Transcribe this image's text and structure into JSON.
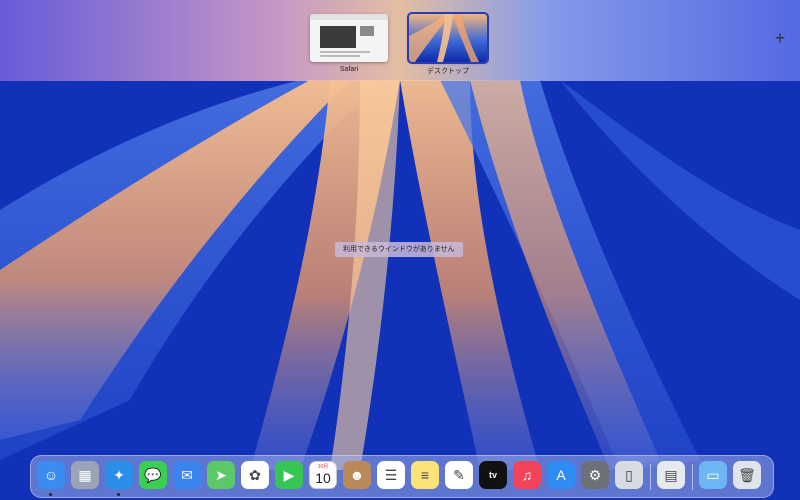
{
  "spaces": {
    "items": [
      {
        "label": "Safari"
      },
      {
        "label": "デスクトップ"
      }
    ],
    "add_symbol": "+"
  },
  "center_message": "利用できるウインドウがありません",
  "dock": {
    "apps": [
      {
        "name": "finder-icon",
        "glyph": "☺",
        "color": "#3b8cf0",
        "running": true
      },
      {
        "name": "launchpad-icon",
        "glyph": "▦",
        "color": "#9aa3b8",
        "running": false
      },
      {
        "name": "safari-icon",
        "glyph": "✦",
        "color": "#2a8fe8",
        "running": true
      },
      {
        "name": "messages-icon",
        "glyph": "💬",
        "color": "#3bcf52",
        "running": false
      },
      {
        "name": "mail-icon",
        "glyph": "✉",
        "color": "#3a84ef",
        "running": false
      },
      {
        "name": "maps-icon",
        "glyph": "➤",
        "color": "#5cc86a",
        "running": false
      },
      {
        "name": "photos-icon",
        "glyph": "✿",
        "color": "#ffffff",
        "running": false
      },
      {
        "name": "facetime-icon",
        "glyph": "▶",
        "color": "#37c553",
        "running": false
      },
      {
        "name": "calendar-icon",
        "glyph": "10",
        "color": "#ffffff",
        "running": false,
        "month": "10月"
      },
      {
        "name": "contacts-icon",
        "glyph": "☻",
        "color": "#b9895a",
        "running": false
      },
      {
        "name": "reminders-icon",
        "glyph": "☰",
        "color": "#ffffff",
        "running": false
      },
      {
        "name": "notes-icon",
        "glyph": "≡",
        "color": "#fbe37a",
        "running": false
      },
      {
        "name": "freeform-icon",
        "glyph": "✎",
        "color": "#ffffff",
        "running": false
      },
      {
        "name": "apple-tv-icon",
        "glyph": "tv",
        "color": "#111111",
        "running": false
      },
      {
        "name": "music-icon",
        "glyph": "♫",
        "color": "#f2435a",
        "running": false
      },
      {
        "name": "app-store-icon",
        "glyph": "A",
        "color": "#2f8cf3",
        "running": false
      },
      {
        "name": "system-settings-icon",
        "glyph": "⚙",
        "color": "#6e7078",
        "running": false
      },
      {
        "name": "iphone-mirroring-icon",
        "glyph": "▯",
        "color": "#d7dbe4",
        "running": false
      },
      {
        "name": "preview-icon",
        "glyph": "▤",
        "color": "#e6e9f0",
        "running": false
      },
      {
        "name": "downloads-folder-icon",
        "glyph": "▭",
        "color": "#6cb7f3",
        "running": false
      },
      {
        "name": "trash-icon",
        "glyph": "🗑",
        "color": "#dfe3ea",
        "running": false
      }
    ]
  }
}
